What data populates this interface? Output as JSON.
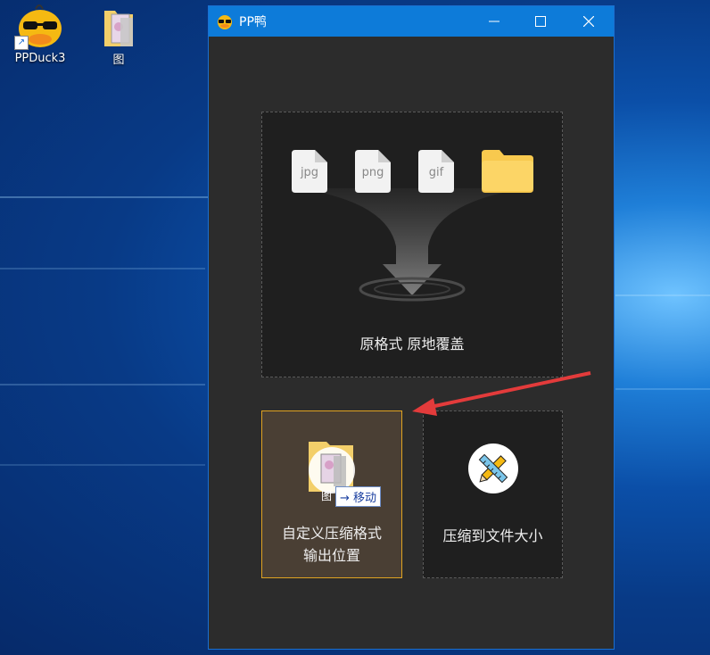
{
  "desktop": {
    "icons": [
      {
        "label": "PPDuck3"
      },
      {
        "label": "图"
      }
    ]
  },
  "window": {
    "title": "PP鸭",
    "controls": {
      "minimize": "minimize-icon",
      "maximize": "maximize-icon",
      "close": "close-icon"
    }
  },
  "main_zone": {
    "files": [
      "jpg",
      "png",
      "gif"
    ],
    "caption": "原格式 原地覆盖"
  },
  "custom_zone": {
    "line1": "自定义压缩格式",
    "line2": "输出位置",
    "drag_badge": "移动",
    "drag_label": "图"
  },
  "size_zone": {
    "caption": "压缩到文件大小",
    "icon": "ruler-pencil-icon"
  },
  "colors": {
    "titlebar": "#0d7bd9",
    "window_bg": "#2c2c2c",
    "zone_bg": "#1f1f1f",
    "accent_border": "#e0a321",
    "arrow": "#e33b3b"
  }
}
